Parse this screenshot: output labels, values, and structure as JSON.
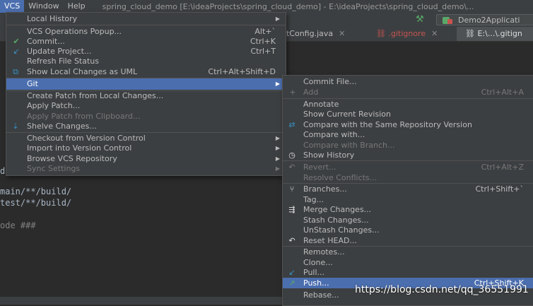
{
  "menubar": {
    "items": [
      "VCS",
      "Window",
      "Help"
    ],
    "title": "spring_cloud_demo [E:\\ideaProjects\\spring_cloud_demo] - E:\\ideaProjects\\spring_cloud_demo\\..."
  },
  "toolbar": {
    "run_config": "Demo2Applicati"
  },
  "tabs": [
    {
      "label": "ntConfig.java"
    },
    {
      "label": ".gitignore"
    },
    {
      "label": "E:\\...\\.gitign"
    }
  ],
  "editor": {
    "lines": [
      "main/**/build/",
      "test/**/build/",
      "ode ###",
      "d"
    ]
  },
  "vcs_menu": {
    "items": [
      {
        "label": "Local History",
        "shortcut": "",
        "submenu": true
      },
      {
        "label": "VCS Operations Popup...",
        "shortcut": "Alt+`"
      },
      {
        "label": "Commit...",
        "shortcut": "Ctrl+K"
      },
      {
        "label": "Update Project...",
        "shortcut": "Ctrl+T"
      },
      {
        "label": "Refresh File Status",
        "shortcut": ""
      },
      {
        "label": "Show Local Changes as UML",
        "shortcut": "Ctrl+Alt+Shift+D"
      },
      {
        "label": "Git",
        "shortcut": "",
        "submenu": true,
        "selected": true
      },
      {
        "label": "Create Patch from Local Changes...",
        "shortcut": ""
      },
      {
        "label": "Apply Patch...",
        "shortcut": ""
      },
      {
        "label": "Apply Patch from Clipboard...",
        "shortcut": "",
        "disabled": true
      },
      {
        "label": "Shelve Changes...",
        "shortcut": ""
      },
      {
        "label": "Checkout from Version Control",
        "shortcut": "",
        "submenu": true
      },
      {
        "label": "Import into Version Control",
        "shortcut": "",
        "submenu": true
      },
      {
        "label": "Browse VCS Repository",
        "shortcut": "",
        "submenu": true
      },
      {
        "label": "Sync Settings",
        "shortcut": "",
        "submenu": true,
        "disabled": true
      }
    ]
  },
  "git_menu": {
    "items": [
      {
        "label": "Commit File...",
        "shortcut": ""
      },
      {
        "label": "Add",
        "shortcut": "Ctrl+Alt+A",
        "disabled": true
      },
      {
        "label": "Annotate",
        "shortcut": ""
      },
      {
        "label": "Show Current Revision",
        "shortcut": ""
      },
      {
        "label": "Compare with the Same Repository Version",
        "shortcut": ""
      },
      {
        "label": "Compare with...",
        "shortcut": ""
      },
      {
        "label": "Compare with Branch...",
        "shortcut": "",
        "disabled": true
      },
      {
        "label": "Show History",
        "shortcut": ""
      },
      {
        "label": "Revert...",
        "shortcut": "Ctrl+Alt+Z",
        "disabled": true
      },
      {
        "label": "Resolve Conflicts...",
        "shortcut": "",
        "disabled": true
      },
      {
        "label": "Branches...",
        "shortcut": "Ctrl+Shift+`"
      },
      {
        "label": "Tag...",
        "shortcut": ""
      },
      {
        "label": "Merge Changes...",
        "shortcut": ""
      },
      {
        "label": "Stash Changes...",
        "shortcut": ""
      },
      {
        "label": "UnStash Changes...",
        "shortcut": ""
      },
      {
        "label": "Reset HEAD...",
        "shortcut": ""
      },
      {
        "label": "Remotes...",
        "shortcut": ""
      },
      {
        "label": "Clone...",
        "shortcut": ""
      },
      {
        "label": "Pull...",
        "shortcut": ""
      },
      {
        "label": "Push...",
        "shortcut": "Ctrl+Shift+K",
        "selected": true
      },
      {
        "label": "Rebase...",
        "shortcut": ""
      }
    ]
  },
  "watermark": "https://blog.csdn.net/qq_36551991",
  "colors": {
    "selection": "#4b6eaf",
    "menu_bg": "#3c3f41",
    "editor_bg": "#2b2b2b"
  }
}
